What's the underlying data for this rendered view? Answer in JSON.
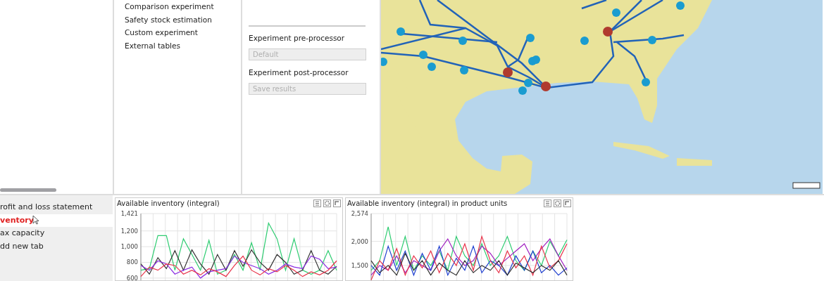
{
  "experiments_list": {
    "items": [
      "Comparison experiment",
      "Safety stock estimation",
      "Custom experiment",
      "External tables"
    ]
  },
  "processor_form": {
    "fields": [
      {
        "label": "Experiment pre-processor",
        "value": "Default",
        "disabled": true
      },
      {
        "label": "Experiment post-processor",
        "value": "Save results",
        "disabled": true
      }
    ]
  },
  "dashboard_tabs": [
    {
      "label": "rofit and loss statement",
      "selected": false
    },
    {
      "label": "ventory",
      "selected": true
    },
    {
      "label": "ax capacity",
      "selected": false
    },
    {
      "label": "dd new tab",
      "selected": false
    }
  ],
  "charts": [
    {
      "title": "Available inventory (integral)",
      "chart_data": {
        "type": "line",
        "grid": true,
        "ylim": [
          545,
          1421
        ],
        "yticks": [
          {
            "value": 1421,
            "label": "1,421"
          },
          {
            "value": 1200,
            "label": "1,200"
          },
          {
            "value": 1000,
            "label": "1,000"
          },
          {
            "value": 800,
            "label": "800"
          },
          {
            "value": 600,
            "label": "600"
          }
        ],
        "series": [
          {
            "color": "#2ecc71",
            "values": [
              700,
              720,
              1140,
              1140,
              700,
              1100,
              900,
              700,
              1080,
              650,
              700,
              900,
              700,
              1050,
              700,
              1300,
              1100,
              700,
              1100,
              700,
              650,
              700,
              950,
              700
            ]
          },
          {
            "color": "#333333",
            "values": [
              780,
              650,
              860,
              720,
              950,
              700,
              960,
              780,
              650,
              900,
              700,
              950,
              750,
              960,
              800,
              700,
              900,
              800,
              650,
              700,
              950,
              700,
              650,
              750
            ]
          },
          {
            "color": "#8a2be2",
            "values": [
              760,
              700,
              820,
              780,
              650,
              700,
              740,
              600,
              680,
              700,
              720,
              880,
              800,
              760,
              720,
              650,
              700,
              780,
              740,
              720,
              880,
              840,
              720,
              740
            ]
          },
          {
            "color": "#e8334a",
            "values": [
              620,
              740,
              700,
              780,
              760,
              650,
              700,
              640,
              720,
              680,
              620,
              760,
              880,
              700,
              640,
              720,
              680,
              760,
              700,
              620,
              680,
              640,
              700,
              820
            ]
          }
        ]
      }
    },
    {
      "title": "Available inventory (integral) in product units",
      "chart_data": {
        "type": "line",
        "grid": true,
        "ylim": [
          1150,
          2574
        ],
        "yticks": [
          {
            "value": 2574,
            "label": "2,574"
          },
          {
            "value": 2000,
            "label": "2,000"
          },
          {
            "value": 1500,
            "label": "1,500"
          }
        ],
        "series": [
          {
            "color": "#2ecc71",
            "values": [
              1400,
              1600,
              2300,
              1500,
              2100,
              1400,
              1700,
              1500,
              1800,
              1400,
              2100,
              1700,
              1500,
              1950,
              1500,
              1700,
              2100,
              1600,
              1400,
              1800,
              1500,
              2000,
              1700,
              2030
            ]
          },
          {
            "color": "#a020c0",
            "values": [
              1300,
              1500,
              1400,
              1700,
              1350,
              1600,
              1500,
              1400,
              1800,
              2050,
              1700,
              1500,
              1600,
              1900,
              1750,
              1500,
              1650,
              1800,
              1950,
              1600,
              1850,
              2050,
              1700,
              1400
            ]
          },
          {
            "color": "#2040d0",
            "values": [
              1500,
              1300,
              1900,
              1400,
              1800,
              1300,
              1750,
              1400,
              1900,
              1300,
              1650,
              1400,
              1900,
              1350,
              1600,
              1500,
              1300,
              1700,
              1400,
              1800,
              1350,
              1500,
              1300,
              1450
            ]
          },
          {
            "color": "#e8334a",
            "values": [
              1200,
              1600,
              1400,
              1850,
              1300,
              1700,
              1450,
              1800,
              1350,
              1750,
              1500,
              1950,
              1400,
              2100,
              1600,
              1350,
              1800,
              1450,
              1700,
              1300,
              1900,
              1450,
              1600,
              1950
            ]
          },
          {
            "color": "#333333",
            "values": [
              1600,
              1350,
              1500,
              1300,
              1750,
              1400,
              1600,
              1300,
              1550,
              1400,
              1300,
              1600,
              1350,
              1500,
              1400,
              1600,
              1300,
              1550,
              1450,
              1350,
              1500,
              1400,
              1600,
              1300
            ]
          }
        ]
      }
    }
  ]
}
